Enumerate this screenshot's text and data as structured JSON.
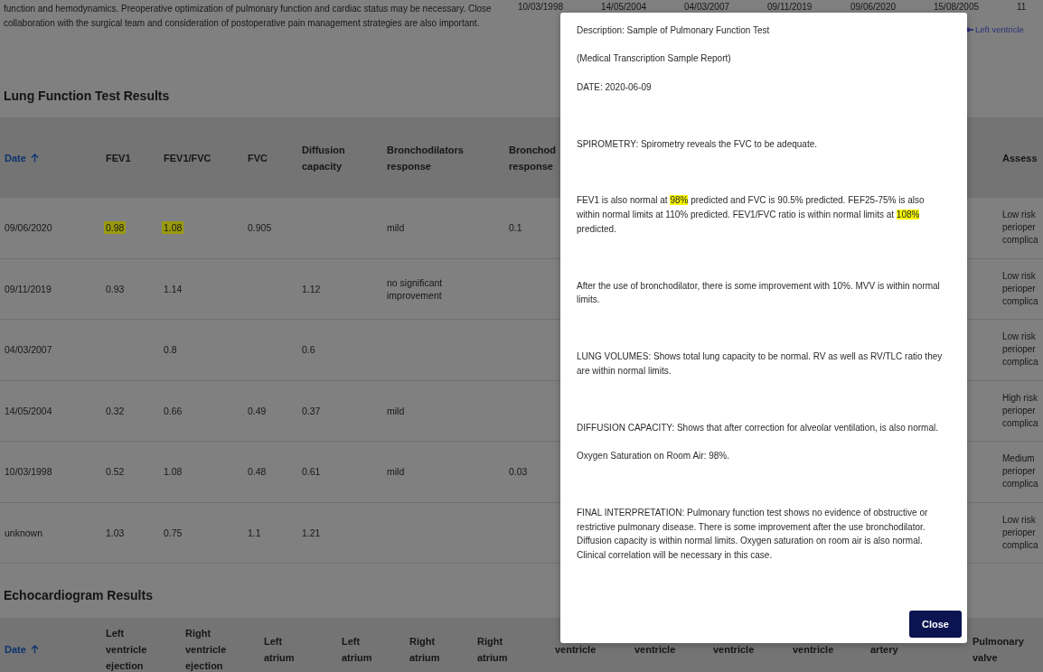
{
  "intro_text": "function and hemodynamics. Preoperative optimization of pulmonary function and cardiac status may be necessary. Close collaboration with the surgical team and consideration of postoperative pain management strategies are also important.",
  "chart": {
    "x_labels": [
      "10/03/1998",
      "14/05/2004",
      "04/03/2007",
      "09/11/2019",
      "09/06/2020",
      "15/08/2005",
      "11"
    ],
    "legend": [
      {
        "label": "Left ventricle",
        "color": "#2e2e78"
      }
    ]
  },
  "lung_section": {
    "title": "Lung Function Test Results",
    "columns": [
      {
        "label": "Date",
        "sorted": true
      },
      {
        "label": "FEV1",
        "sorted": false
      },
      {
        "label": "FEV1/FVC",
        "sorted": false
      },
      {
        "label": "FVC",
        "sorted": false
      },
      {
        "label": "Diffusion capacity",
        "sorted": false
      },
      {
        "label": "Bronchodilators response",
        "sorted": false
      },
      {
        "label": "Bronchod\nresponse",
        "sorted": false
      },
      {
        "label": "Assess",
        "sorted": false
      }
    ],
    "rows": [
      [
        {
          "text": "09/06/2020",
          "highlighted": false
        },
        {
          "text": "0.98",
          "highlighted": true
        },
        {
          "text": "1.08",
          "highlighted": true
        },
        {
          "text": "0.905",
          "highlighted": false
        },
        null,
        {
          "text": "mild",
          "highlighted": false
        },
        {
          "text": "0.1",
          "highlighted": false
        },
        {
          "text": "Low risk\nperioper\ncomplica",
          "highlighted": false
        }
      ],
      [
        {
          "text": "09/11/2019",
          "highlighted": false
        },
        {
          "text": "0.93",
          "highlighted": false
        },
        {
          "text": "1.14",
          "highlighted": false
        },
        null,
        {
          "text": "1.12",
          "highlighted": false
        },
        {
          "text": "no significant improvement",
          "highlighted": false
        },
        null,
        {
          "text": "Low risk\nperioper\ncomplica",
          "highlighted": false
        }
      ],
      [
        {
          "text": "04/03/2007",
          "highlighted": false
        },
        null,
        {
          "text": "0.8",
          "highlighted": false
        },
        null,
        {
          "text": "0.6",
          "highlighted": false
        },
        null,
        null,
        {
          "text": "Low risk\nperioper\ncomplica",
          "highlighted": false
        }
      ],
      [
        {
          "text": "14/05/2004",
          "highlighted": false
        },
        {
          "text": "0.32",
          "highlighted": false
        },
        {
          "text": "0.66",
          "highlighted": false
        },
        {
          "text": "0.49",
          "highlighted": false
        },
        {
          "text": "0.37",
          "highlighted": false
        },
        {
          "text": "mild",
          "highlighted": false
        },
        null,
        {
          "text": "High risk\nperioper\ncomplica",
          "highlighted": false
        }
      ],
      [
        {
          "text": "10/03/1998",
          "highlighted": false
        },
        {
          "text": "0.52",
          "highlighted": false
        },
        {
          "text": "1.08",
          "highlighted": false
        },
        {
          "text": "0.48",
          "highlighted": false
        },
        {
          "text": "0.61",
          "highlighted": false
        },
        {
          "text": "mild",
          "highlighted": false
        },
        {
          "text": "0.03",
          "highlighted": false
        },
        {
          "text": "Medium\nperioper\ncomplica",
          "highlighted": false
        }
      ],
      [
        {
          "text": "unknown",
          "highlighted": false
        },
        {
          "text": "1.03",
          "highlighted": false
        },
        {
          "text": "0.75",
          "highlighted": false
        },
        {
          "text": "1.1",
          "highlighted": false
        },
        {
          "text": "1.21",
          "highlighted": false
        },
        null,
        null,
        {
          "text": "Low risk\nperioper\ncomplica",
          "highlighted": false
        }
      ]
    ]
  },
  "echo_section": {
    "title": "Echocardiogram Results",
    "columns": [
      {
        "lines": [
          "Date"
        ],
        "sorted": true
      },
      {
        "lines": [
          "Left",
          "ventricle",
          "ejection"
        ],
        "sorted": false
      },
      {
        "lines": [
          "Right",
          "ventricle",
          "ejection"
        ],
        "sorted": false
      },
      {
        "lines": [
          "Left",
          "atrium"
        ],
        "sorted": false
      },
      {
        "lines": [
          "Left",
          "atrium"
        ],
        "sorted": false
      },
      {
        "lines": [
          "Right",
          "atrium"
        ],
        "sorted": false
      },
      {
        "lines": [
          "Right",
          "atrium"
        ],
        "sorted": false
      },
      {
        "lines": [
          "ventricle"
        ],
        "sorted": false
      },
      {
        "lines": [
          "ventricle"
        ],
        "sorted": false
      },
      {
        "lines": [
          "ventricle"
        ],
        "sorted": false
      },
      {
        "lines": [
          "ventricle"
        ],
        "sorted": false
      },
      {
        "lines": [
          "artery"
        ],
        "sorted": false
      },
      {
        "lines": [
          "Pulmonary",
          "valve"
        ],
        "sorted": false
      }
    ]
  },
  "modal": {
    "segments": [
      {
        "text": "Description: Sample of Pulmonary Function Test\n\n(Medical Transcription Sample Report)\n\nDATE: 2020-06-09\n\n\n\nSPIROMETRY: Spirometry reveals the FVC to be adequate.\n\n\n\nFEV1 is also normal at ",
        "highlighted": false
      },
      {
        "text": "98%",
        "highlighted": true
      },
      {
        "text": " predicted and FVC is 90.5% predicted. FEF25-75% is also within normal limits at 110% predicted. FEV1/FVC ratio is within normal limits at ",
        "highlighted": false
      },
      {
        "text": "108%",
        "highlighted": true
      },
      {
        "text": " predicted.\n\n\n\nAfter the use of bronchodilator, there is some improvement with 10%. MVV is within normal limits.\n\n\n\nLUNG VOLUMES: Shows total lung capacity to be normal. RV as well as RV/TLC ratio they are within normal limits.\n\n\n\nDIFFUSION CAPACITY: Shows that after correction for alveolar ventilation, is also normal.\n\nOxygen Saturation on Room Air: 98%.\n\n\n\nFINAL INTERPRETATION: Pulmonary function test shows no evidence of obstructive or restrictive pulmonary disease. There is some improvement after the use bronchodilator. Diffusion capacity is within normal limits. Oxygen saturation on room air is also normal. Clinical correlation will be necessary in this case.",
        "highlighted": false
      }
    ],
    "close_label": "Close"
  }
}
